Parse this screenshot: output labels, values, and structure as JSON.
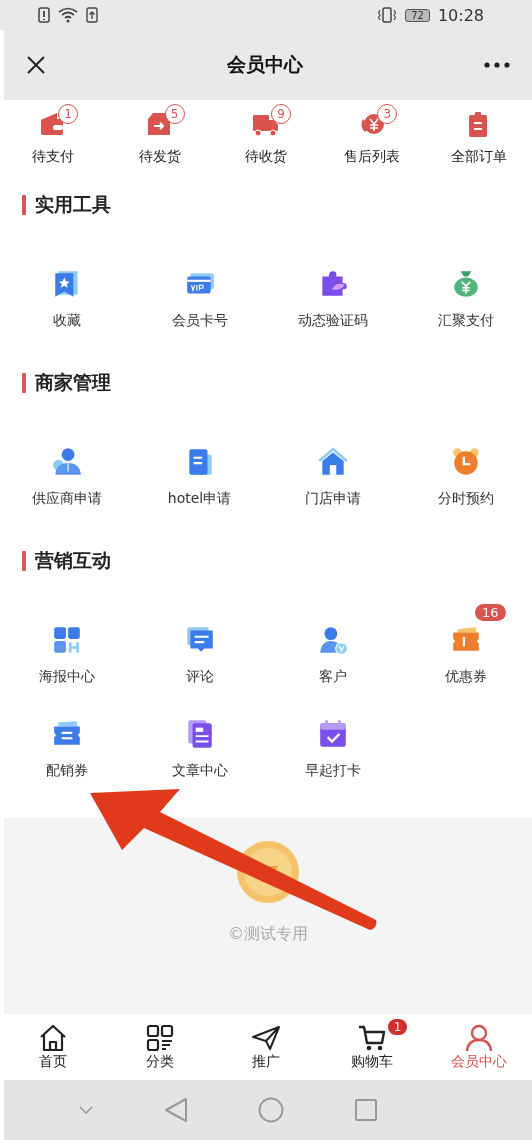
{
  "status_bar": {
    "battery": "72",
    "time": "10:28"
  },
  "header": {
    "title": "会员中心"
  },
  "orders": [
    {
      "label": "待支付",
      "badge": "1"
    },
    {
      "label": "待发货",
      "badge": "5"
    },
    {
      "label": "待收货",
      "badge": "9"
    },
    {
      "label": "售后列表",
      "badge": "3"
    },
    {
      "label": "全部订单"
    }
  ],
  "sections": [
    {
      "title": "实用工具",
      "items": [
        {
          "label": "收藏"
        },
        {
          "label": "会员卡号"
        },
        {
          "label": "动态验证码"
        },
        {
          "label": "汇聚支付"
        }
      ]
    },
    {
      "title": "商家管理",
      "items": [
        {
          "label": "供应商申请"
        },
        {
          "label": "hotel申请"
        },
        {
          "label": "门店申请"
        },
        {
          "label": "分时预约"
        }
      ]
    },
    {
      "title": "营销互动",
      "items": [
        {
          "label": "海报中心"
        },
        {
          "label": "评论"
        },
        {
          "label": "客户"
        },
        {
          "label": "优惠券",
          "badge": "16"
        },
        {
          "label": "配销券"
        },
        {
          "label": "文章中心"
        },
        {
          "label": "早起打卡"
        }
      ]
    }
  ],
  "footer": {
    "copyright": "©测试专用"
  },
  "tab_bar": [
    {
      "label": "首页",
      "selected": false
    },
    {
      "label": "分类",
      "selected": false
    },
    {
      "label": "推广",
      "selected": false
    },
    {
      "label": "购物车",
      "selected": false,
      "badge": "1"
    },
    {
      "label": "会员中心",
      "selected": true
    }
  ]
}
